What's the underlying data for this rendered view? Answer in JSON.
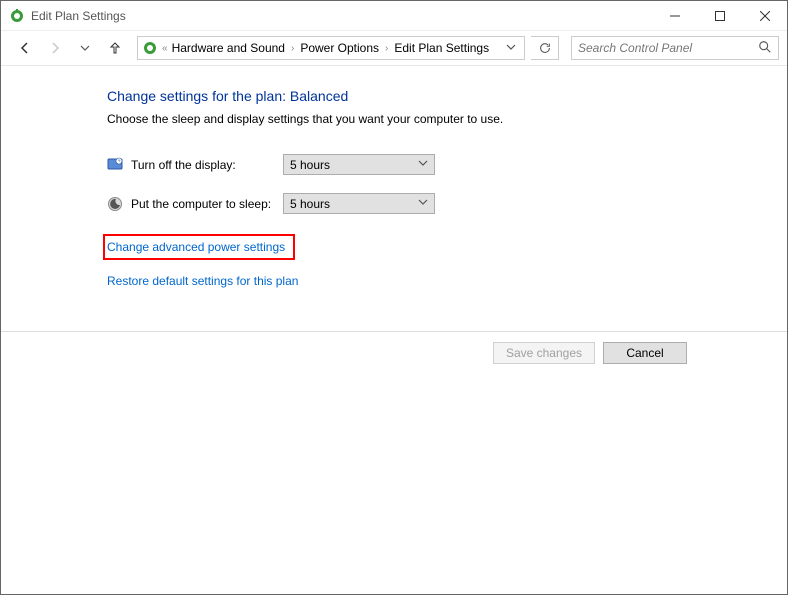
{
  "window": {
    "title": "Edit Plan Settings"
  },
  "breadcrumb": {
    "prefix_glyph": "«",
    "items": [
      "Hardware and Sound",
      "Power Options",
      "Edit Plan Settings"
    ]
  },
  "search": {
    "placeholder": "Search Control Panel"
  },
  "main": {
    "heading": "Change settings for the plan: Balanced",
    "subtext": "Choose the sleep and display settings that you want your computer to use.",
    "rows": [
      {
        "label": "Turn off the display:",
        "value": "5 hours"
      },
      {
        "label": "Put the computer to sleep:",
        "value": "5 hours"
      }
    ],
    "links": {
      "advanced": "Change advanced power settings",
      "restore": "Restore default settings for this plan"
    }
  },
  "footer": {
    "save": "Save changes",
    "cancel": "Cancel"
  }
}
